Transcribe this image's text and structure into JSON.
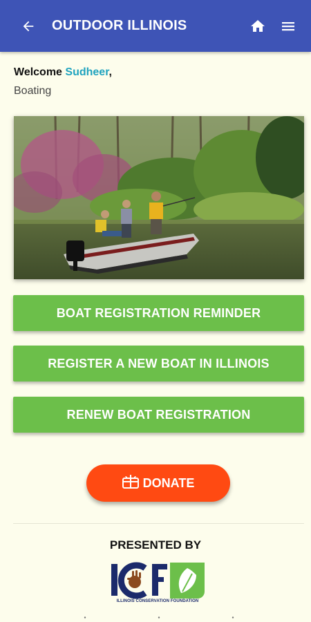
{
  "appbar": {
    "title": "OUTDOOR ILLINOIS",
    "icons": [
      "back-arrow-icon",
      "home-icon",
      "menu-icon"
    ],
    "color": "#3e54b6"
  },
  "welcome": {
    "prefix": "Welcome ",
    "name": "Sudheer",
    "suffix": ",",
    "subtitle": "Boating",
    "name_color": "#1fa3bf"
  },
  "hero": {
    "description_icon": "boat-fishing-photo"
  },
  "actions": {
    "reminder": "BOAT REGISTRATION REMINDER",
    "register": "REGISTER A NEW BOAT IN ILLINOIS",
    "renew": "RENEW BOAT REGISTRATION",
    "button_color": "#6cbf4a"
  },
  "donate": {
    "label": "DONATE",
    "icon": "gift-card-icon",
    "color": "#ff4a12"
  },
  "footer": {
    "presented_by": "PRESENTED BY",
    "logo_text": "ICF",
    "logo_caption": "ILLINOIS CONSERVATION FOUNDATION"
  }
}
